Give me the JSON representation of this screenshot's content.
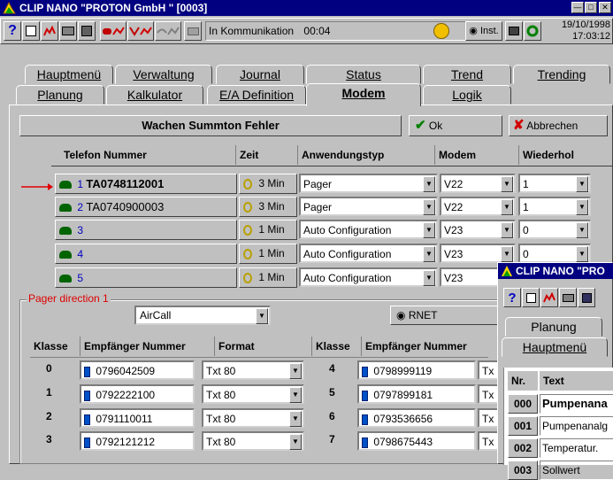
{
  "window": {
    "title": "CLIP NANO \"PROTON GmbH    \" [0003]"
  },
  "toolbar": {
    "status": "In Kommunikation",
    "counter": "00:04",
    "inst_label": "Inst.",
    "date": "19/10/1998",
    "time": "17:03:12"
  },
  "tabs_row1": [
    "Hauptmenü",
    "Verwaltung",
    "Journal",
    "Status",
    "Trend",
    "Trending"
  ],
  "tabs_row2": [
    "Planung",
    "Kalkulator",
    "E/A Definition",
    "Modem",
    "Logik"
  ],
  "action_bar": {
    "status_text": "Wachen  Summton Fehler",
    "ok_label": "Ok",
    "cancel_label": "Abbrechen"
  },
  "phone_table": {
    "headers": [
      "Telefon Nummer",
      "Zeit",
      "Anwendungstyp",
      "Modem",
      "Wiederhol"
    ],
    "rows": [
      {
        "idx": "1",
        "number": "TA0748112001",
        "zeit": "3 Min",
        "typ": "Pager",
        "modem": "V22",
        "wieder": "1"
      },
      {
        "idx": "2",
        "number": "TA0740900003",
        "zeit": "3 Min",
        "typ": "Pager",
        "modem": "V22",
        "wieder": "1"
      },
      {
        "idx": "3",
        "number": "",
        "zeit": "1 Min",
        "typ": "Auto Configuration",
        "modem": "V23",
        "wieder": "0"
      },
      {
        "idx": "4",
        "number": "",
        "zeit": "1 Min",
        "typ": "Auto Configuration",
        "modem": "V23",
        "wieder": "0"
      },
      {
        "idx": "5",
        "number": "",
        "zeit": "1 Min",
        "typ": "Auto Configuration",
        "modem": "V23",
        "wieder": ""
      }
    ]
  },
  "pager": {
    "legend": "Pager direction 1",
    "service": "AirCall",
    "network": "RNET",
    "left_headers": [
      "Klasse",
      "Empfänger Nummer",
      "Format"
    ],
    "right_headers": [
      "Klasse",
      "Empfänger Nummer"
    ],
    "left_rows": [
      {
        "klasse": "0",
        "nummer": "0796042509",
        "format": "Txt 80"
      },
      {
        "klasse": "1",
        "nummer": "0792222100",
        "format": "Txt 80"
      },
      {
        "klasse": "2",
        "nummer": "0791110011",
        "format": "Txt 80"
      },
      {
        "klasse": "3",
        "nummer": "0792121212",
        "format": "Txt 80"
      }
    ],
    "right_rows": [
      {
        "klasse": "4",
        "nummer": "0798999119",
        "format": "Tx"
      },
      {
        "klasse": "5",
        "nummer": "0797899181",
        "format": "Tx"
      },
      {
        "klasse": "6",
        "nummer": "0793536656",
        "format": "Tx"
      },
      {
        "klasse": "7",
        "nummer": "0798675443",
        "format": "Tx"
      }
    ]
  },
  "second_window": {
    "title": "CLIP NANO \"PRO",
    "tabs": [
      "Planung",
      "Hauptmenü"
    ],
    "headers": [
      "Nr.",
      "Text"
    ],
    "rows": [
      {
        "nr": "000",
        "text": "Pumpenana"
      },
      {
        "nr": "001",
        "text": "Pumpenanalg"
      },
      {
        "nr": "002",
        "text": "Temperatur."
      },
      {
        "nr": "003",
        "text": "Sollwert"
      }
    ]
  }
}
